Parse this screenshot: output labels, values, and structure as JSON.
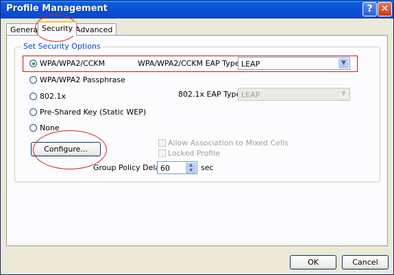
{
  "window": {
    "title": "Profile Management",
    "help_glyph": "?",
    "close_glyph": "✕"
  },
  "tabs": [
    {
      "label": "General"
    },
    {
      "label": "Security"
    },
    {
      "label": "Advanced"
    }
  ],
  "security": {
    "group_title": "Set Security Options",
    "options": [
      {
        "label": "WPA/WPA2/CCKM",
        "selected": true
      },
      {
        "label": "WPA/WPA2 Passphrase",
        "selected": false
      },
      {
        "label": "802.1x",
        "selected": false
      },
      {
        "label": "Pre-Shared Key (Static WEP)",
        "selected": false
      },
      {
        "label": "None",
        "selected": false
      }
    ],
    "wpa_eap_label": "WPA/WPA2/CCKM EAP Type:",
    "wpa_eap_value": "LEAP",
    "eap_8021x_label": "802.1x EAP Type:",
    "eap_8021x_value": "LEAP",
    "configure_label": "Configure...",
    "allow_mixed_label": "Allow Association to Mixed Cells",
    "locked_profile_label": "Locked Profile",
    "group_policy_label": "Group Policy Delay:",
    "group_policy_value": "60",
    "group_policy_unit": "sec"
  },
  "buttons": {
    "ok": "OK",
    "cancel": "Cancel"
  },
  "colors": {
    "highlight": "#d32020",
    "title_bar": "#0a4fd6",
    "group_title": "#0046d5"
  }
}
